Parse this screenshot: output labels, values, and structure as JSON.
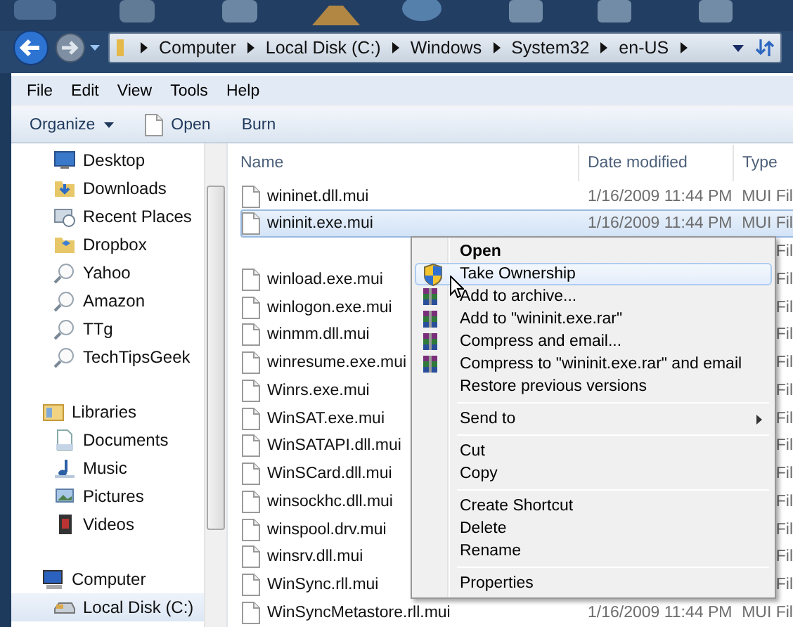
{
  "address_bar": {
    "crumbs": [
      "Computer",
      "Local Disk (C:)",
      "Windows",
      "System32",
      "en-US"
    ]
  },
  "menu_bar": [
    "File",
    "Edit",
    "View",
    "Tools",
    "Help"
  ],
  "command_bar": [
    {
      "label": "Organize",
      "kind": "dropdown"
    },
    {
      "label": "Open",
      "kind": "file"
    },
    {
      "label": "Burn",
      "kind": "plain"
    }
  ],
  "navigation": [
    {
      "label": "Desktop",
      "kind": "desktop",
      "selected": false
    },
    {
      "label": "Downloads",
      "kind": "downloads",
      "selected": false
    },
    {
      "label": "Recent Places",
      "kind": "recent",
      "selected": false
    },
    {
      "label": "Dropbox",
      "kind": "dropbox",
      "selected": false
    },
    {
      "label": "Yahoo",
      "kind": "search",
      "selected": false
    },
    {
      "label": "Amazon",
      "kind": "search",
      "selected": false
    },
    {
      "label": "TTg",
      "kind": "search",
      "selected": false
    },
    {
      "label": "TechTipsGeek",
      "kind": "search",
      "selected": false
    },
    {
      "label": "Libraries",
      "kind": "library",
      "selected": false,
      "children": [
        {
          "label": "Documents",
          "kind": "documents",
          "selected": false
        },
        {
          "label": "Music",
          "kind": "music",
          "selected": false
        },
        {
          "label": "Pictures",
          "kind": "pictures",
          "selected": false
        },
        {
          "label": "Videos",
          "kind": "videos",
          "selected": false
        }
      ]
    },
    {
      "label": "Computer",
      "kind": "computer",
      "selected": false,
      "children": [
        {
          "label": "Local Disk (C:)",
          "kind": "drive",
          "selected": true
        }
      ]
    }
  ],
  "file_list": {
    "columns": [
      "Name",
      "Date modified",
      "Type"
    ],
    "rows": [
      {
        "name": "wininet.dll.mui",
        "date": "1/16/2009 11:44 PM",
        "type": "MUI Fil",
        "selected": false
      },
      {
        "name": "wininit.exe.mui",
        "date": "1/16/2009 11:44 PM",
        "type": "MUI Fil",
        "selected": true
      },
      {
        "type": "Fil",
        "selected": false
      },
      {
        "name": "winload.exe.mui",
        "type": "Fil",
        "selected": false
      },
      {
        "name": "winlogon.exe.mui",
        "type": "Fil",
        "selected": false
      },
      {
        "name": "winmm.dll.mui",
        "type": "Fil",
        "selected": false
      },
      {
        "name": "winresume.exe.mui",
        "type": "Fil",
        "selected": false
      },
      {
        "name": "Winrs.exe.mui",
        "type": "Fil",
        "selected": false
      },
      {
        "name": "WinSAT.exe.mui",
        "type": "Fil",
        "selected": false
      },
      {
        "name": "WinSATAPI.dll.mui",
        "type": "Fil",
        "selected": false
      },
      {
        "name": "WinSCard.dll.mui",
        "type": "Fil",
        "selected": false
      },
      {
        "name": "winsockhc.dll.mui",
        "type": "Fil",
        "selected": false
      },
      {
        "name": "winspool.drv.mui",
        "type": "Fil",
        "selected": false
      },
      {
        "name": "winsrv.dll.mui",
        "type": "Fil",
        "selected": false
      },
      {
        "name": "WinSync.rll.mui",
        "type": "Fil",
        "selected": false
      },
      {
        "name": "WinSyncMetastore.rll.mui",
        "date": "1/16/2009 11:44 PM",
        "type": "MUI Fil",
        "selected": false
      }
    ]
  },
  "context_menu": [
    {
      "kind": "default",
      "label": "Open",
      "selected": false
    },
    {
      "kind": "elevated",
      "label": "Take Ownership",
      "selected": true
    },
    {
      "kind": "archive",
      "label": "Add to archive...",
      "selected": false
    },
    {
      "kind": "archive",
      "label": "Add to \"wininit.exe.rar\"",
      "selected": false
    },
    {
      "kind": "archive",
      "label": "Compress and email...",
      "selected": false
    },
    {
      "kind": "archive",
      "label": "Compress to \"wininit.exe.rar\" and email",
      "selected": false
    },
    {
      "kind": "item",
      "label": "Restore previous versions",
      "selected": false
    },
    {
      "kind": "separator"
    },
    {
      "kind": "submenu",
      "label": "Send to",
      "selected": false
    },
    {
      "kind": "separator"
    },
    {
      "kind": "item",
      "label": "Cut",
      "selected": false
    },
    {
      "kind": "item",
      "label": "Copy",
      "selected": false
    },
    {
      "kind": "separator"
    },
    {
      "kind": "item",
      "label": "Create Shortcut",
      "selected": false
    },
    {
      "kind": "item",
      "label": "Delete",
      "selected": false
    },
    {
      "kind": "item",
      "label": "Rename",
      "selected": false
    },
    {
      "kind": "separator"
    },
    {
      "kind": "item",
      "label": "Properties",
      "selected": false
    }
  ]
}
